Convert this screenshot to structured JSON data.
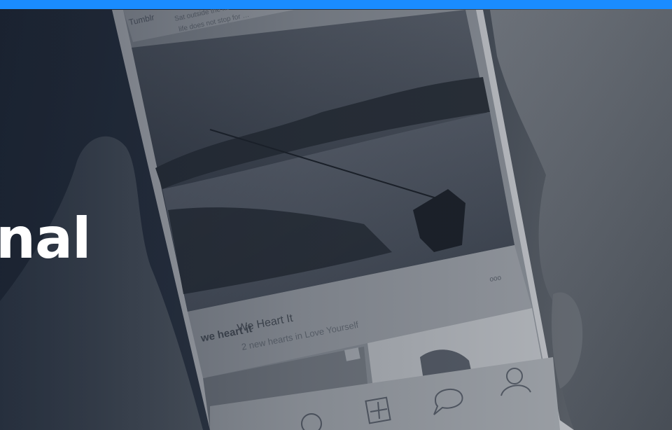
{
  "hero": {
    "headline": "nal"
  },
  "phone_feed": {
    "top_post_app": "Tumblr",
    "top_post_text": "Sat outside the house and …",
    "top_post_sub": "life does not stop for …",
    "post_app": "We Heart It",
    "post_text": "2 new hearts in Love Yourself",
    "post_logo": "we heart it",
    "more_dots": "ooo"
  },
  "tab_bar": {
    "icons": [
      "home-icon",
      "search-icon",
      "add-post-icon",
      "comment-icon",
      "profile-icon"
    ]
  },
  "colors": {
    "accent_bar": "#1a8cff",
    "background": "#1e2633"
  }
}
